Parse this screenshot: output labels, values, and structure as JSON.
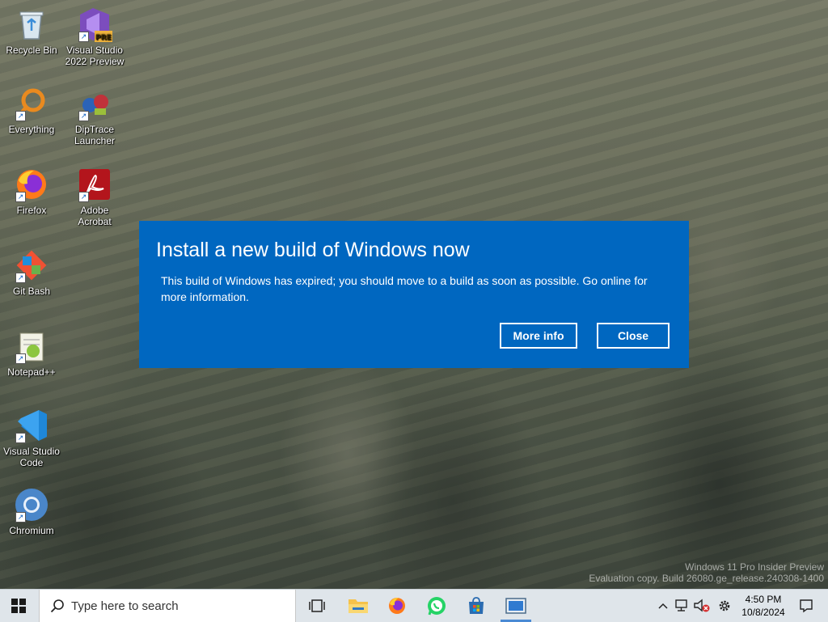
{
  "desktop": {
    "icons": [
      {
        "label": "Recycle Bin",
        "icon": "recycle-bin-icon"
      },
      {
        "label": "Visual Studio 2022 Preview",
        "icon": "visual-studio-preview-icon",
        "badge": "PRE"
      },
      {
        "label": "Everything",
        "icon": "everything-search-icon"
      },
      {
        "label": "DipTrace Launcher",
        "icon": "diptrace-icon"
      },
      {
        "label": "Firefox",
        "icon": "firefox-icon"
      },
      {
        "label": "Adobe Acrobat",
        "icon": "adobe-acrobat-icon"
      },
      {
        "label": "Git Bash",
        "icon": "git-bash-icon"
      },
      {
        "label": "Notepad++",
        "icon": "notepad-plus-plus-icon"
      },
      {
        "label": "Visual Studio Code",
        "icon": "vscode-icon"
      },
      {
        "label": "Chromium",
        "icon": "chromium-icon"
      }
    ]
  },
  "dialog": {
    "title": "Install a new build of Windows now",
    "message": "This build of Windows has expired; you should move to a build as soon as possible. Go online for more information.",
    "more_info_label": "More info",
    "close_label": "Close",
    "background": "#0067c0"
  },
  "watermark": {
    "line1": "Windows 11 Pro Insider Preview",
    "line2": "Evaluation copy. Build 26080.ge_release.240308-1400"
  },
  "taskbar": {
    "search_placeholder": "Type here to search",
    "apps": [
      {
        "name": "task-view-icon"
      },
      {
        "name": "file-explorer-icon"
      },
      {
        "name": "firefox-icon"
      },
      {
        "name": "whatsapp-icon"
      },
      {
        "name": "microsoft-store-icon"
      },
      {
        "name": "active-window-icon"
      }
    ],
    "tray": {
      "time": "4:50 PM",
      "date": "10/8/2024"
    }
  },
  "colors": {
    "accent": "#0067c0",
    "taskbar": "#dfe5ea"
  }
}
